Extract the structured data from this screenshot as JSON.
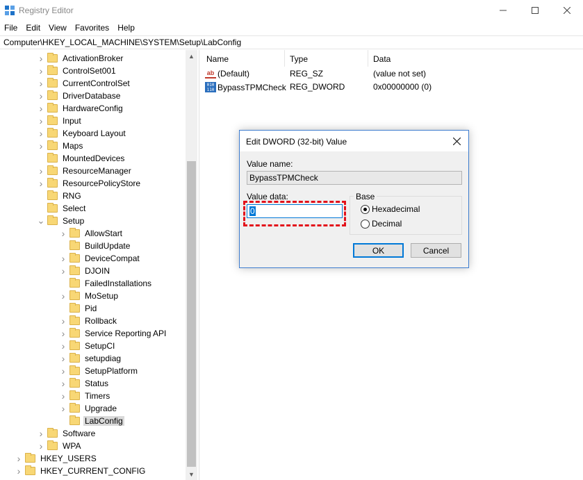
{
  "window": {
    "title": "Registry Editor"
  },
  "menu": [
    "File",
    "Edit",
    "View",
    "Favorites",
    "Help"
  ],
  "address": "Computer\\HKEY_LOCAL_MACHINE\\SYSTEM\\Setup\\LabConfig",
  "tree": [
    {
      "label": "ActivationBroker",
      "level": 1,
      "expander": "collapsed"
    },
    {
      "label": "ControlSet001",
      "level": 1,
      "expander": "collapsed"
    },
    {
      "label": "CurrentControlSet",
      "level": 1,
      "expander": "collapsed"
    },
    {
      "label": "DriverDatabase",
      "level": 1,
      "expander": "collapsed"
    },
    {
      "label": "HardwareConfig",
      "level": 1,
      "expander": "collapsed"
    },
    {
      "label": "Input",
      "level": 1,
      "expander": "collapsed"
    },
    {
      "label": "Keyboard Layout",
      "level": 1,
      "expander": "collapsed"
    },
    {
      "label": "Maps",
      "level": 1,
      "expander": "collapsed"
    },
    {
      "label": "MountedDevices",
      "level": 1,
      "expander": "none"
    },
    {
      "label": "ResourceManager",
      "level": 1,
      "expander": "collapsed"
    },
    {
      "label": "ResourcePolicyStore",
      "level": 1,
      "expander": "collapsed"
    },
    {
      "label": "RNG",
      "level": 1,
      "expander": "none"
    },
    {
      "label": "Select",
      "level": 1,
      "expander": "none"
    },
    {
      "label": "Setup",
      "level": 1,
      "expander": "expanded"
    },
    {
      "label": "AllowStart",
      "level": 2,
      "expander": "collapsed"
    },
    {
      "label": "BuildUpdate",
      "level": 2,
      "expander": "none"
    },
    {
      "label": "DeviceCompat",
      "level": 2,
      "expander": "collapsed"
    },
    {
      "label": "DJOIN",
      "level": 2,
      "expander": "collapsed"
    },
    {
      "label": "FailedInstallations",
      "level": 2,
      "expander": "none"
    },
    {
      "label": "MoSetup",
      "level": 2,
      "expander": "collapsed"
    },
    {
      "label": "Pid",
      "level": 2,
      "expander": "none"
    },
    {
      "label": "Rollback",
      "level": 2,
      "expander": "collapsed"
    },
    {
      "label": "Service Reporting API",
      "level": 2,
      "expander": "collapsed"
    },
    {
      "label": "SetupCI",
      "level": 2,
      "expander": "collapsed"
    },
    {
      "label": "setupdiag",
      "level": 2,
      "expander": "collapsed"
    },
    {
      "label": "SetupPlatform",
      "level": 2,
      "expander": "collapsed"
    },
    {
      "label": "Status",
      "level": 2,
      "expander": "collapsed"
    },
    {
      "label": "Timers",
      "level": 2,
      "expander": "collapsed"
    },
    {
      "label": "Upgrade",
      "level": 2,
      "expander": "collapsed"
    },
    {
      "label": "LabConfig",
      "level": 2,
      "expander": "none",
      "selected": true
    },
    {
      "label": "Software",
      "level": 1,
      "expander": "collapsed"
    },
    {
      "label": "WPA",
      "level": 1,
      "expander": "collapsed"
    },
    {
      "label": "HKEY_USERS",
      "level": 0,
      "expander": "collapsed"
    },
    {
      "label": "HKEY_CURRENT_CONFIG",
      "level": 0,
      "expander": "collapsed"
    }
  ],
  "list": {
    "columns": [
      "Name",
      "Type",
      "Data"
    ],
    "rows": [
      {
        "name": "(Default)",
        "type": "REG_SZ",
        "data": "(value not set)",
        "icon": "string-value-icon"
      },
      {
        "name": "BypassTPMCheck",
        "type": "REG_DWORD",
        "data": "0x00000000 (0)",
        "icon": "binary-value-icon"
      }
    ]
  },
  "dialog": {
    "title": "Edit DWORD (32-bit) Value",
    "value_name_label": "Value name:",
    "value_name": "BypassTPMCheck",
    "value_data_label": "Value data:",
    "value_data": "0",
    "base_label": "Base",
    "hex_label": "Hexadecimal",
    "decimal_label": "Decimal",
    "base_selected": "Hexadecimal",
    "ok_label": "OK",
    "cancel_label": "Cancel"
  },
  "colors": {
    "highlight_border": "#e3111b",
    "accent": "#0078d7",
    "folder": "#f8d775"
  }
}
